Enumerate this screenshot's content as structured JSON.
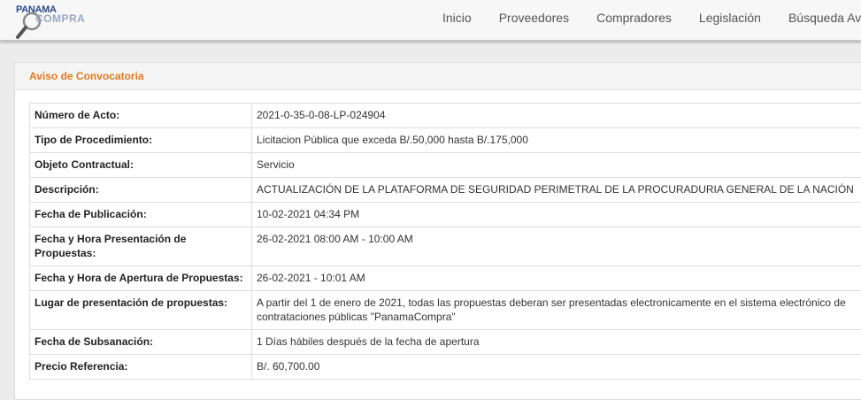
{
  "header": {
    "logo": {
      "text_top": "PANAMA",
      "text_bottom": "COMPRA"
    },
    "nav": [
      {
        "label": "Inicio"
      },
      {
        "label": "Proveedores"
      },
      {
        "label": "Compradores"
      },
      {
        "label": "Legislación"
      },
      {
        "label": "Búsqueda Av"
      }
    ]
  },
  "panel": {
    "title": "Aviso de Convocatoria",
    "rows": [
      {
        "label": "Número de Acto:",
        "value": "2021-0-35-0-08-LP-024904"
      },
      {
        "label": "Tipo de Procedimiento:",
        "value": "Licitacion Pública que exceda B/.50,000 hasta B/.175,000"
      },
      {
        "label": "Objeto Contractual:",
        "value": "Servicio"
      },
      {
        "label": "Descripción:",
        "value": "ACTUALIZACIÓN DE LA PLATAFORMA DE SEGURIDAD PERIMETRAL DE LA PROCURADURIA GENERAL DE LA NACIÓN"
      },
      {
        "label": "Fecha de Publicación:",
        "value": "10-02-2021 04:34 PM"
      },
      {
        "label": "Fecha y Hora Presentación de Propuestas:",
        "value": "26-02-2021 08:00 AM - 10:00 AM"
      },
      {
        "label": "Fecha y Hora de Apertura de Propuestas:",
        "value": "26-02-2021 - 10:01 AM"
      },
      {
        "label": "Lugar de presentación de propuestas:",
        "value": "A partir del 1 de enero de 2021, todas las propuestas deberan ser presentadas electronicamente en el sistema electrónico de contrataciones públicas \"PanamaCompra\""
      },
      {
        "label": "Fecha de Subsanación:",
        "value": "1 Días hábiles después de la fecha de apertura"
      },
      {
        "label": "Precio Referencia:",
        "value": "B/. 60,700.00"
      }
    ]
  },
  "colors": {
    "accent": "#e07a1e",
    "logo_blue": "#2c4a87"
  }
}
